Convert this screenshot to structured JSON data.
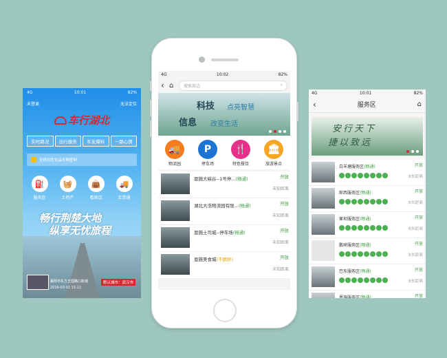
{
  "left": {
    "status_left": "4G",
    "time": "10:01",
    "battery": "82%",
    "login": "未登录",
    "locate": "无法定位",
    "logo": "车行湖北",
    "tabs": [
      "实时路况",
      "出行服务",
      "车友爆料",
      "一路心情"
    ],
    "notice": "全线对危化品车辆管制",
    "icons": [
      {
        "label": "服务区",
        "icon": "service-area-icon",
        "glyph": "⛽"
      },
      {
        "label": "土特产",
        "icon": "basket-icon",
        "glyph": "🧺"
      },
      {
        "label": "看周边",
        "icon": "bag-icon",
        "glyph": "👜"
      },
      {
        "label": "车货通",
        "icon": "truck-icon",
        "glyph": "🚚"
      }
    ],
    "slogan1": "畅行荆楚大地",
    "slogan2": "纵享无忧旅程",
    "cam_text": "襄阳市东方王国路口新城",
    "cam_date": "2016-03-02 15:11",
    "city": "默认城市：武汉市"
  },
  "center": {
    "status_left": "4G",
    "time": "10:02",
    "battery": "82%",
    "search_placeholder": "搜索周边",
    "banner": {
      "l1a": "科技",
      "l1b": "点亮智慧",
      "l2a": "信息",
      "l2b": "改变生活"
    },
    "categories": [
      {
        "label": "物流园",
        "color": "#f57c20",
        "glyph": "🚚",
        "icon": "logistics-icon"
      },
      {
        "label": "停车场",
        "color": "#1e73d2",
        "glyph": "P",
        "icon": "parking-icon"
      },
      {
        "label": "特色餐饮",
        "color": "#e8308a",
        "glyph": "🍴",
        "icon": "dining-icon"
      },
      {
        "label": "旅游景点",
        "color": "#f5a623",
        "glyph": "🏛",
        "icon": "scenic-icon"
      }
    ],
    "list": [
      {
        "name": "恩施大峡谷--1号停...",
        "tag": "(畅通)",
        "warn": false,
        "open": "开放",
        "dist": "未知距离"
      },
      {
        "name": "湖北大浩物流园有限...",
        "tag": "(畅通)",
        "warn": false,
        "open": "开放",
        "dist": "未知距离"
      },
      {
        "name": "恩施土司城--停车场",
        "tag": "(畅通)",
        "warn": false,
        "open": "开放",
        "dist": "未知距离"
      },
      {
        "name": "恩施美食城",
        "tag": "(不拥挤)",
        "warn": true,
        "open": "开放",
        "dist": "未知距离"
      }
    ]
  },
  "right": {
    "status_left": "4G",
    "time": "10:01",
    "battery": "82%",
    "title": "服务区",
    "banner_l1": "安行天下",
    "banner_l2": "捷以致远",
    "list": [
      {
        "name": "白羊塘服务区",
        "tag": "(畅通)",
        "open": "开放",
        "dist": "未知距离",
        "placeholder": false
      },
      {
        "name": "郎西服务区",
        "tag": "(畅通)",
        "open": "开放",
        "dist": "未知距离",
        "placeholder": false
      },
      {
        "name": "崔坝服务区",
        "tag": "(畅通)",
        "open": "开放",
        "dist": "未知距离",
        "placeholder": false
      },
      {
        "name": "鹏峡服务区",
        "tag": "(畅通)",
        "open": "开放",
        "dist": "未知距离",
        "placeholder": true
      },
      {
        "name": "巴东服务区",
        "tag": "(畅通)",
        "open": "开放",
        "dist": "未知距离",
        "placeholder": false
      },
      {
        "name": "恩施服务区",
        "tag": "(畅通)",
        "open": "开放",
        "dist": "",
        "placeholder": false
      }
    ]
  }
}
